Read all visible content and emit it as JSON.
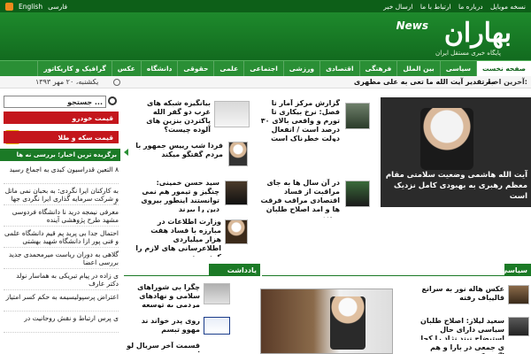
{
  "topbar": {
    "links": [
      "ارسال خبر",
      "ارتباط با ما",
      "درباره ما",
      "نسخه موبایل"
    ],
    "lang_en": "English",
    "lang_fa": "فارسی"
  },
  "header": {
    "logo_news": "News",
    "logo_main": "بهاران",
    "logo_sub": "پایگاه خبری مستقل ایران"
  },
  "nav": {
    "items": [
      "صفحه نخست",
      "سیاسی",
      "بین الملل",
      "فرهنگی",
      "اقتصادی",
      "ورزشی",
      "اجتماعی",
      "علمی",
      "حقوقی",
      "دانشگاه",
      "عکس",
      "گرافیک و کاریکاتور"
    ]
  },
  "ticker": {
    "label": "آخرین اخبار:",
    "text": "مه تقدیر آیت الله ما تعی به علی مطهری",
    "date": "یکشنبه، ۲۰ مهر ۱۳۹۳"
  },
  "sidebar": {
    "search_placeholder": "جستجو ...",
    "car_price": "قیمت خودرو",
    "coin_price": "قیمت سکه و طلا",
    "latest_head": "برگزیده ترین اخبار؛ بررسی نه ها",
    "items": [
      "۸ التعین قدراسیون کبدی به اجماع رسید",
      "به کارکنان ایرا نگردی: به بحبان نمی ماتل و شرکت سرمایه گذاری ایرا نگردی جها نگردی",
      "معرفی نیمجه درید نا دانشگاه فردوسی مشهد طرح پژوهشی آینده",
      "احتمال جدا بی پرید پم قیم دانشگاه علمی و فنی پور ازا دانشگاه شهید بهشتی",
      "گلاهی به دوران ریاست میرمحمدی جدید بررسی اعضا",
      "ی زاده در پیام تبریکی به هماسار نولد دکتر عارف",
      "اعتراض پرسپولیسیمه به حکم کسر امتیاز",
      "ی پرس ارتباط و نقش روحانیت در"
    ]
  },
  "news": {
    "c1": "بیانگیزه شبکه های غرب دو گفر الله پاکتردن بنزین های آلوده چیست؟",
    "c2": "گزارش مرکز آمار تا فصل: نرخ بیکاری تا تورم و واقعی بالای ۳۰ درصد است / انفعال دولت خطرناک است",
    "c3": "فردا شب رییس جمهور با مردم گفتگو میکند",
    "c4": "سید حسن خمینی: چنگیز و تیمور هم نمی توانستند اینطور بیروی دین را ببرند",
    "c5": "در آن سال ها به جای مراقبت از فساد اقتصادی مراقب فرقت ها و امد اصلاح طلبان بودند",
    "c6": "وزارت اطلاعات در مبارزه با فساد هفت هزار میلیاردی اطلاعرسانی های لازم را کرده بود"
  },
  "featured": {
    "caption": "آیت الله هاشمی وضعیت سلامتی مقام معظم رهبری به بهبودی کامل نزدیک است"
  },
  "sections": {
    "notes": "یادداشت",
    "politics": "سیاسی"
  },
  "bottom": {
    "n1": "چگرا بی شوراهای سلامی و نهادهای مردمی به توسعه",
    "n2": "روی پدر خواند ند مهوو تبسم",
    "n3": "قسمت آخر سریال لو ای",
    "r1": "عکس هاله نور به سرانع قالیباف رفته",
    "r2": "سعید لیلاز: اصلاح طلبان سیاسی دارای حال استیضاح نیند نژاد را کجا دچت",
    "r3": "ی جمعی در بارا و هم اگر ر کدی"
  }
}
